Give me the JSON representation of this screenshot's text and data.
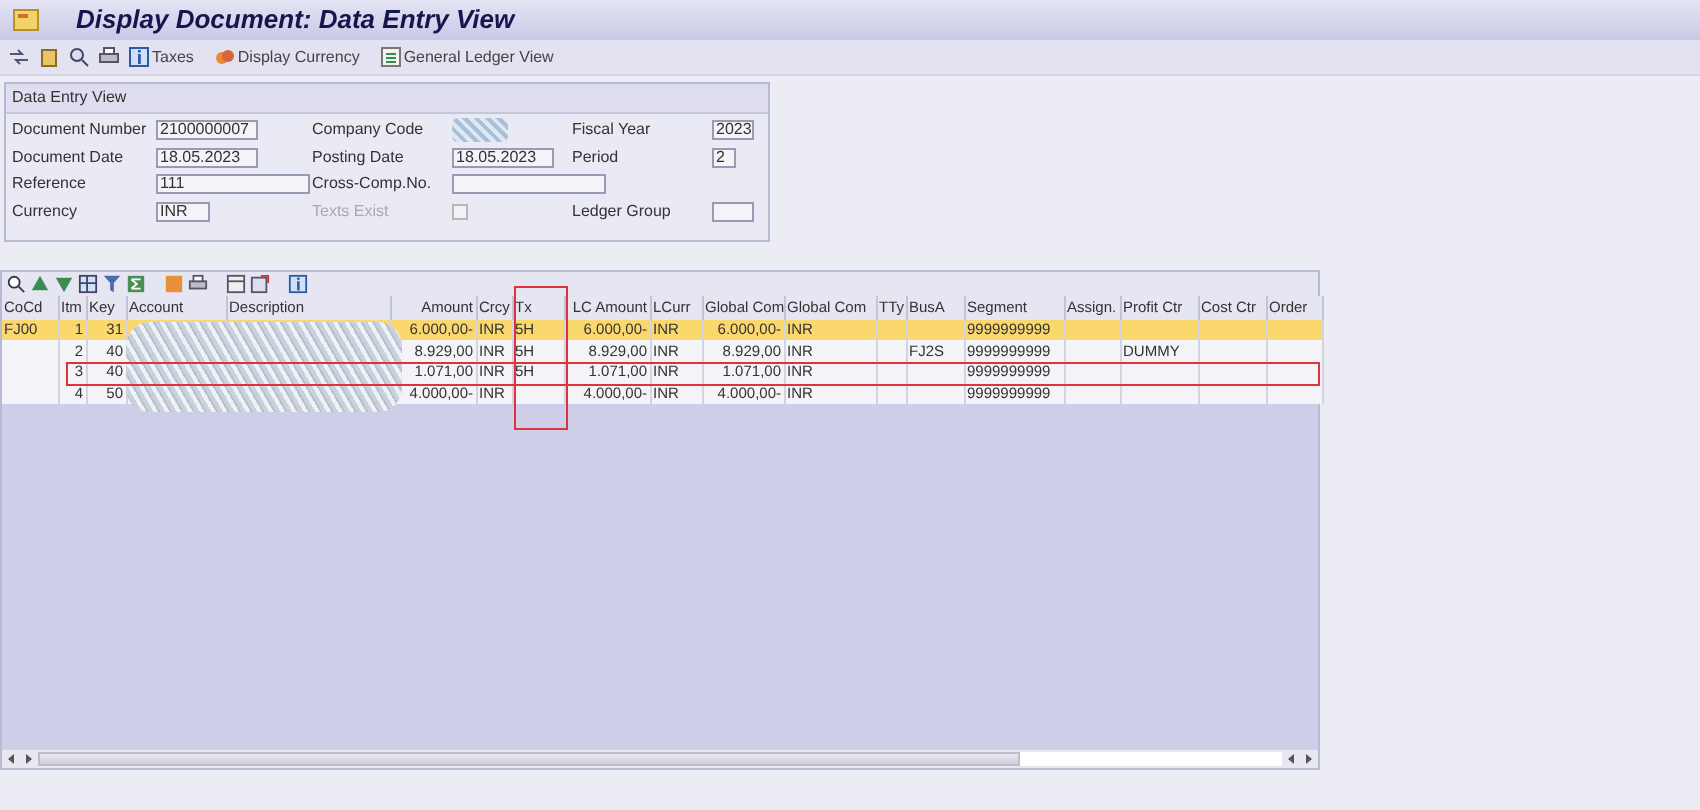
{
  "window": {
    "title": "Display Document: Data Entry View"
  },
  "toolbar": [
    {
      "kind": "icon"
    },
    {
      "kind": "icon"
    },
    {
      "kind": "icon"
    },
    {
      "kind": "icon"
    },
    {
      "kind": "button",
      "label": "Taxes"
    },
    {
      "kind": "button",
      "label": "Display Currency"
    },
    {
      "kind": "button",
      "label": "General Ledger View"
    }
  ],
  "header": {
    "title": "Data Entry View",
    "rows": [
      [
        {
          "label": "Document Number",
          "kind": "field",
          "value": "2100000007"
        },
        {
          "label": "Company Code",
          "kind": "redacted"
        },
        {
          "label": "Fiscal Year",
          "kind": "field",
          "value": "2023"
        }
      ],
      [
        {
          "label": "Document Date",
          "kind": "field",
          "value": "18.05.2023"
        },
        {
          "label": "Posting Date",
          "kind": "field",
          "value": "18.05.2023"
        },
        {
          "label": "Period",
          "kind": "field",
          "value": "2"
        }
      ],
      [
        {
          "label": "Reference",
          "kind": "field",
          "value": "111"
        },
        {
          "label": "Cross-Comp.No.",
          "kind": "field"
        }
      ],
      [
        {
          "label": "Currency",
          "kind": "field",
          "value": "INR"
        },
        {
          "label": "Texts Exist",
          "kind": "checkbox",
          "disabled": true,
          "checked": false
        },
        {
          "label": "Ledger Group",
          "kind": "field"
        }
      ]
    ]
  },
  "grid": {
    "columns": [
      {
        "label": "CoCd",
        "framed": false
      },
      {
        "label": "Itm",
        "framed": false
      },
      {
        "label": "Key",
        "framed": false
      },
      {
        "label": "Account",
        "framed": false
      },
      {
        "label": "Description",
        "framed": false
      },
      {
        "label": "Amount",
        "framed": false
      },
      {
        "label": "Crcy",
        "framed": false
      },
      {
        "label": "Tx",
        "framed": true
      },
      {
        "label": "LC Amount",
        "framed": false
      },
      {
        "label": "LCurr",
        "framed": false
      },
      {
        "label": "Global Com",
        "framed": false
      },
      {
        "label": "Global Com",
        "framed": false
      },
      {
        "label": "TTy",
        "framed": false
      },
      {
        "label": "BusA",
        "framed": false
      },
      {
        "label": "Segment",
        "framed": false
      },
      {
        "label": "Assign.",
        "framed": false
      },
      {
        "label": "Profit Ctr",
        "framed": false
      },
      {
        "label": "Cost Ctr",
        "framed": false
      },
      {
        "label": "Order",
        "framed": false
      }
    ],
    "rows": [
      {
        "selected": true,
        "framed": false,
        "cells": [
          "FJ00",
          "1",
          "31",
          null,
          null,
          "6.000,00-",
          "INR",
          "5H",
          "6.000,00-",
          "INR",
          "6.000,00-",
          "INR",
          null,
          null,
          "9999999999",
          null,
          null,
          null,
          null
        ]
      },
      {
        "selected": false,
        "framed": false,
        "cells": [
          null,
          "2",
          "40",
          null,
          null,
          "8.929,00",
          "INR",
          "5H",
          "8.929,00",
          "INR",
          "8.929,00",
          "INR",
          null,
          "FJ2S",
          "9999999999",
          null,
          "DUMMY",
          null,
          null
        ]
      },
      {
        "selected": false,
        "framed": true,
        "cells": [
          null,
          "3",
          "40",
          null,
          null,
          "1.071,00",
          "INR",
          "5H",
          "1.071,00",
          "INR",
          "1.071,00",
          "INR",
          null,
          null,
          "9999999999",
          null,
          null,
          null,
          null
        ]
      },
      {
        "selected": false,
        "framed": false,
        "cells": [
          null,
          "4",
          "50",
          null,
          null,
          "4.000,00-",
          "INR",
          null,
          "4.000,00-",
          "INR",
          "4.000,00-",
          "INR",
          null,
          null,
          "9999999999",
          null,
          null,
          null,
          null
        ]
      }
    ]
  }
}
